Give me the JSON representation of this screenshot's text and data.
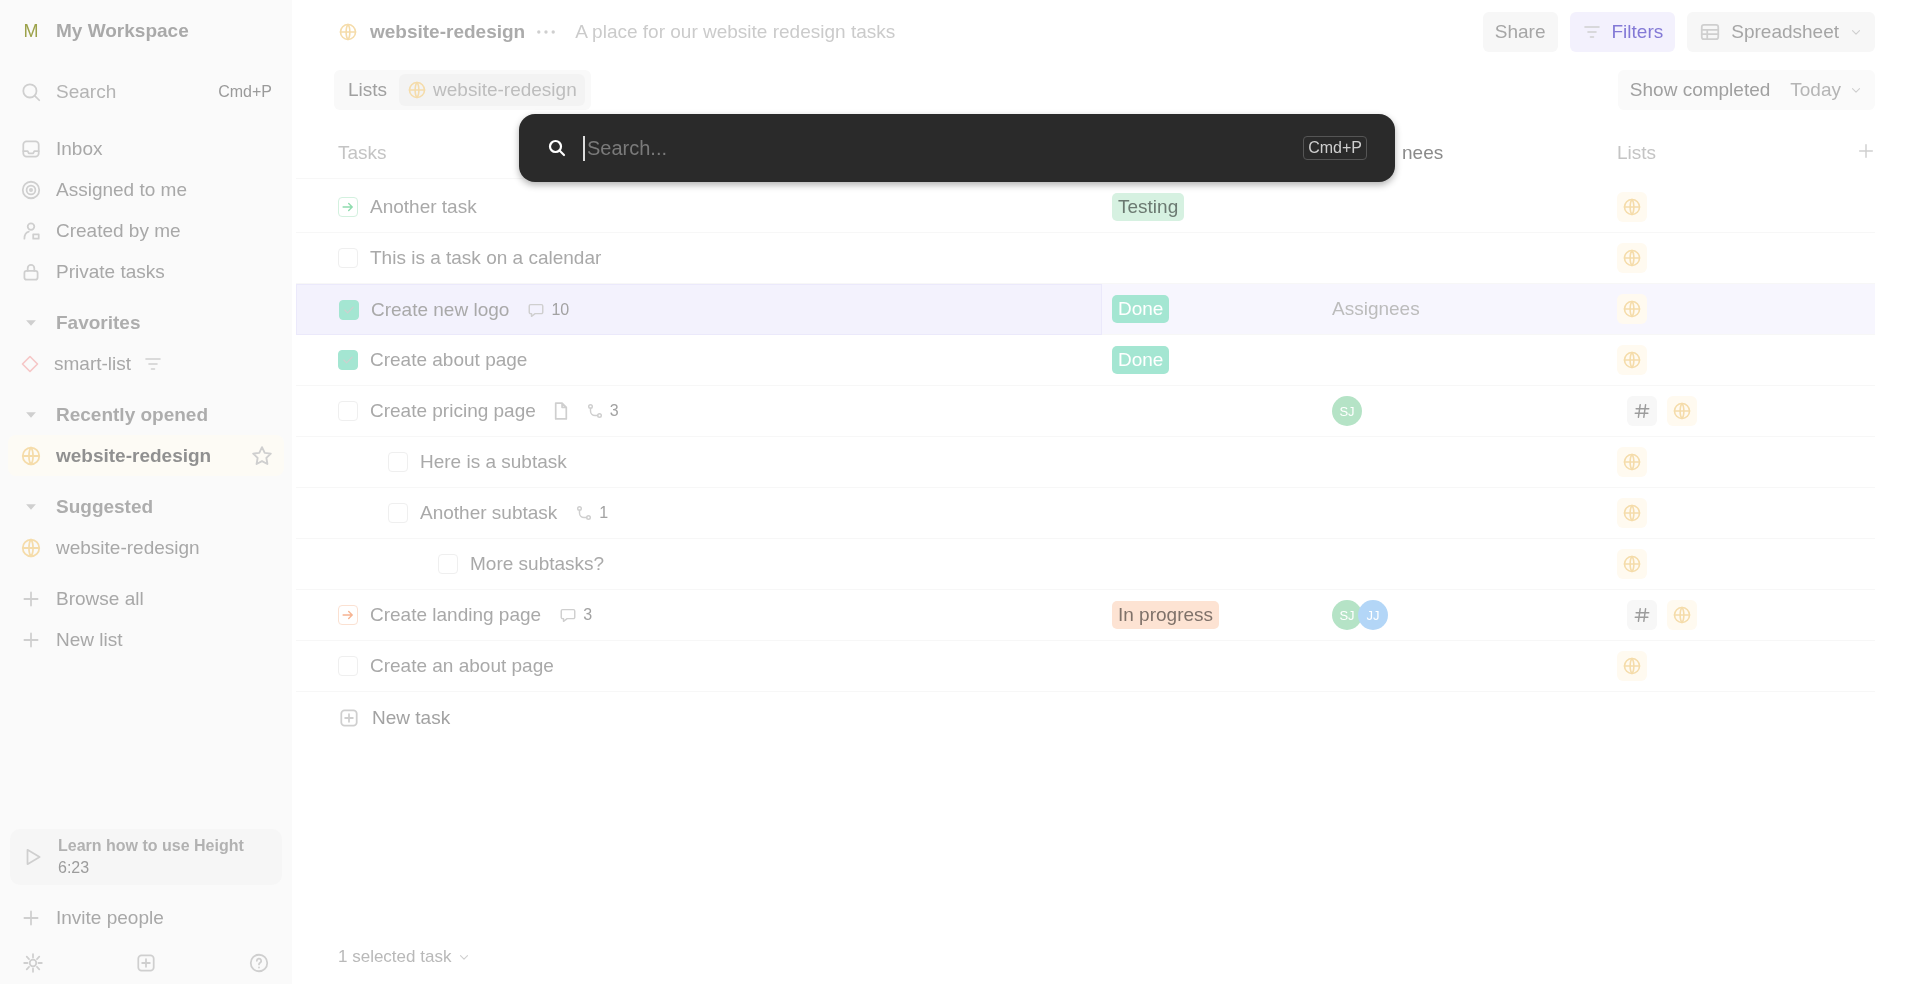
{
  "sidebar": {
    "workspace": {
      "initial": "M",
      "name": "My Workspace"
    },
    "search": {
      "label": "Search",
      "shortcut": "Cmd+P"
    },
    "nav": [
      {
        "kind": "inbox",
        "label": "Inbox"
      },
      {
        "kind": "assigned",
        "label": "Assigned to me"
      },
      {
        "kind": "created",
        "label": "Created by me"
      },
      {
        "kind": "private",
        "label": "Private tasks"
      }
    ],
    "sections": [
      {
        "title": "Favorites",
        "expanded": true,
        "items": [
          {
            "kind": "smart-list",
            "label": "smart-list",
            "filtered": true,
            "selected": false
          }
        ]
      },
      {
        "title": "Recently opened",
        "expanded": true,
        "items": [
          {
            "kind": "list",
            "label": "website-redesign",
            "selected": true,
            "starred": false
          }
        ]
      },
      {
        "title": "Suggested",
        "expanded": true,
        "items": [
          {
            "kind": "list",
            "label": "website-redesign",
            "selected": false
          }
        ]
      }
    ],
    "actions": [
      {
        "label": "Browse all"
      },
      {
        "label": "New list"
      }
    ],
    "tutorial": {
      "title": "Learn how to use Height",
      "duration": "6:23"
    },
    "invite": {
      "label": "Invite people"
    }
  },
  "header": {
    "list_name": "website-redesign",
    "description": "A place for our website redesign tasks",
    "buttons": [
      {
        "kind": "share",
        "label": "Share",
        "active": false
      },
      {
        "kind": "filters",
        "label": "Filters",
        "active": true
      },
      {
        "kind": "view",
        "label": "Spreadsheet",
        "active": false
      }
    ]
  },
  "toolbar": {
    "breadcrumb": [
      {
        "kind": "text",
        "label": "Lists"
      },
      {
        "kind": "list",
        "label": "website-redesign"
      }
    ],
    "show_completed": "Show completed",
    "date_filter": "Today"
  },
  "table": {
    "columns": [
      {
        "label": "Tasks"
      },
      {
        "label": "nees"
      },
      {
        "label": "Lists"
      }
    ],
    "rows": [
      {
        "name": "Another task",
        "kind": "started",
        "selected": false,
        "status": {
          "label": "Testing",
          "kind": "soft",
          "color": "#d6f1e1"
        },
        "lists": [
          {
            "kind": "list"
          }
        ]
      },
      {
        "name": "This is a task on a calendar",
        "kind": "todo",
        "selected": false,
        "lists": [
          {
            "kind": "list"
          }
        ]
      },
      {
        "name": "Create new logo",
        "kind": "done",
        "selected": true,
        "comments": "10",
        "status": {
          "label": "Done",
          "kind": "solid",
          "color": "#a4e6d2"
        },
        "assignee_placeholder": "Assignees",
        "lists": [
          {
            "kind": "list"
          }
        ]
      },
      {
        "name": "Create about page",
        "kind": "done",
        "selected": false,
        "status": {
          "label": "Done",
          "kind": "solid",
          "color": "#a4e6d2"
        },
        "lists": [
          {
            "kind": "list"
          }
        ]
      },
      {
        "name": "Create pricing page",
        "kind": "todo",
        "selected": false,
        "attachment": true,
        "subtasks": "3",
        "assignees": [
          {
            "initials": "SJ",
            "color": "#b5e3c6"
          }
        ],
        "lists": [
          {
            "kind": "tag"
          },
          {
            "kind": "list"
          }
        ],
        "children": [
          {
            "name": "Here is a subtask",
            "kind": "todo",
            "selected": false,
            "lists": [
              {
                "kind": "list"
              }
            ]
          },
          {
            "name": "Another subtask",
            "kind": "todo",
            "selected": false,
            "subtasks": "1",
            "lists": [
              {
                "kind": "list"
              }
            ],
            "children": [
              {
                "name": "More subtasks?",
                "kind": "todo",
                "selected": false,
                "lists": [
                  {
                    "kind": "list"
                  }
                ]
              }
            ]
          }
        ]
      },
      {
        "name": "Create landing page",
        "kind": "in-progress",
        "selected": false,
        "comments": "3",
        "status": {
          "label": "In progress",
          "kind": "soft",
          "color": "#fde3d3"
        },
        "assignees": [
          {
            "initials": "SJ",
            "color": "#b5e3c6"
          },
          {
            "initials": "JJ",
            "color": "#b3d6f7"
          }
        ],
        "lists": [
          {
            "kind": "tag"
          },
          {
            "kind": "list"
          }
        ]
      },
      {
        "name": "Create an about page",
        "kind": "todo",
        "selected": false,
        "lists": [
          {
            "kind": "list"
          }
        ]
      }
    ],
    "new_task": "New task"
  },
  "footer": {
    "selection": "1 selected task"
  },
  "search_dialog": {
    "placeholder": "Search...",
    "shortcut": "Cmd+P"
  }
}
